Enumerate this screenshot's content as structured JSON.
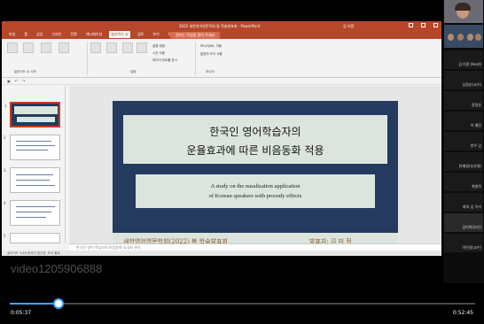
{
  "window": {
    "title": "2022 새한영어영문학회 봄 학술발표회 - PowerPoint",
    "user": "김 미정"
  },
  "menu": {
    "tabs": [
      "파일",
      "홈",
      "삽입",
      "디자인",
      "전환",
      "애니메이션",
      "슬라이드 쇼",
      "검토",
      "보기",
      "도움말"
    ],
    "active_index": 6,
    "search": "원하는 작업을 알려 주세요"
  },
  "ribbon": {
    "groups": [
      "슬라이드 쇼 시작",
      "설정",
      "모니터"
    ],
    "options": [
      "설명 재생",
      "시간 사용",
      "미디어 컨트롤 표시"
    ],
    "monitor_value": "모니터(M): 자동",
    "presenter_view": "발표자 보기 사용"
  },
  "slide": {
    "title_line1": "한국인 영어학습자의",
    "title_line2": "운율효과에 따른 비음동화 적용",
    "eng_line1": "A study on the nasalization application",
    "eng_line2": "of Korean speakers with prosody effects",
    "conference": "새한영어영문학회(2022) 봄 학술발표회",
    "presenter": "발표자:  김 미 정"
  },
  "notes_placeholder": "한국인 영어 학습자의 비음동화 요국와 관리",
  "statusbar": "슬라이드 1/18   한국어   접근성: 조사 필요",
  "participants": [
    {
      "name": ""
    },
    {
      "name": ""
    },
    {
      "name": "김 미정 (Host)"
    },
    {
      "name": "심정순(교수)"
    },
    {
      "name": "장정순"
    },
    {
      "name": "이 예진"
    },
    {
      "name": "한우 김"
    },
    {
      "name": "한혜영(부산대)"
    },
    {
      "name": "최병옥"
    },
    {
      "name": "회의 김 우리"
    },
    {
      "name": "김미희(부산)"
    },
    {
      "name": "이민경(교수)"
    }
  ],
  "player": {
    "video_title": "video1205906888",
    "current_time": "0:05:37",
    "total_time": "0:52:45",
    "progress": 0.105
  }
}
